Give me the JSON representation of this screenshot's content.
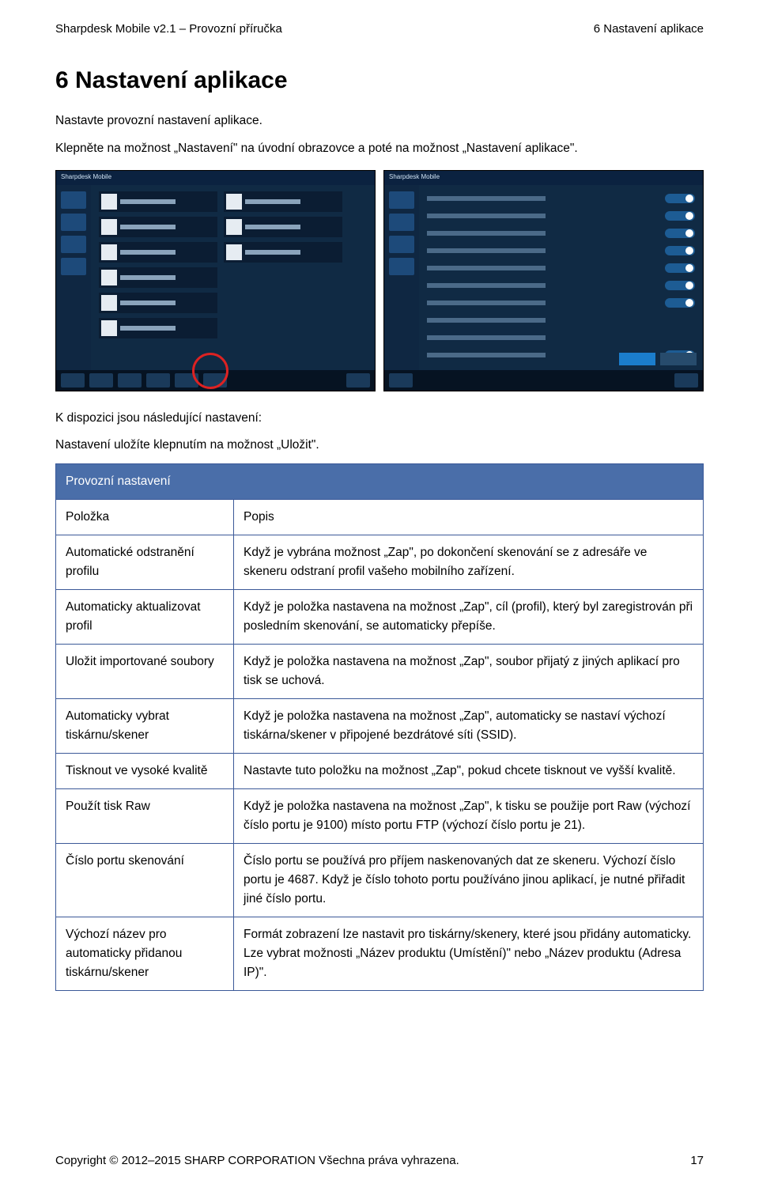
{
  "header": {
    "left": "Sharpdesk Mobile v2.1 – Provozní příručka",
    "right": "6 Nastavení aplikace"
  },
  "section": {
    "number_title": "6   Nastavení aplikace",
    "intro1": "Nastavte provozní nastavení aplikace.",
    "intro2": "Klepněte na možnost „Nastavení\" na úvodní obrazovce a poté na možnost „Nastavení aplikace\".",
    "after_img1": "K dispozici jsou následující nastavení:",
    "after_img2": "Nastavení uložíte klepnutím na možnost „Uložit\"."
  },
  "screenshots": {
    "left_title": "Sharpdesk Mobile",
    "right_title": "Sharpdesk Mobile"
  },
  "table": {
    "category": "Provozní nastavení",
    "col_item": "Položka",
    "col_desc": "Popis",
    "rows": [
      {
        "item": "Automatické odstranění profilu",
        "desc": "Když je vybrána možnost „Zap\", po dokončení skenování se z adresáře ve skeneru odstraní profil vašeho mobilního zařízení."
      },
      {
        "item": "Automaticky aktualizovat profil",
        "desc": "Když je položka nastavena na možnost „Zap\", cíl (profil), který byl zaregistrován při posledním skenování, se automaticky přepíše."
      },
      {
        "item": "Uložit importované soubory",
        "desc": "Když je položka nastavena na možnost „Zap\", soubor přijatý z jiných aplikací pro tisk se uchová."
      },
      {
        "item": "Automaticky vybrat tiskárnu/skener",
        "desc": "Když je položka nastavena na možnost „Zap\", automaticky se nastaví výchozí tiskárna/skener v připojené bezdrátové síti (SSID)."
      },
      {
        "item": "Tisknout ve vysoké kvalitě",
        "desc": "Nastavte tuto položku na možnost „Zap\", pokud chcete tisknout ve vyšší kvalitě."
      },
      {
        "item": "Použít tisk Raw",
        "desc": "Když je položka nastavena na možnost „Zap\", k tisku se použije port Raw (výchozí číslo portu je 9100) místo portu FTP (výchozí číslo portu je 21)."
      },
      {
        "item": "Číslo portu skenování",
        "desc": "Číslo portu se používá pro příjem naskenovaných dat ze skeneru. Výchozí číslo portu je 4687. Když je číslo tohoto portu používáno jinou aplikací, je nutné přiřadit jiné číslo portu."
      },
      {
        "item": "Výchozí název pro automaticky přidanou tiskárnu/skener",
        "desc": "Formát zobrazení lze nastavit pro tiskárny/skenery, které jsou přidány automaticky. Lze vybrat možnosti „Název produktu (Umístění)\" nebo „Název produktu (Adresa IP)\"."
      }
    ]
  },
  "footer": {
    "left": "Copyright © 2012–2015 SHARP CORPORATION Všechna práva vyhrazena.",
    "right": "17"
  }
}
